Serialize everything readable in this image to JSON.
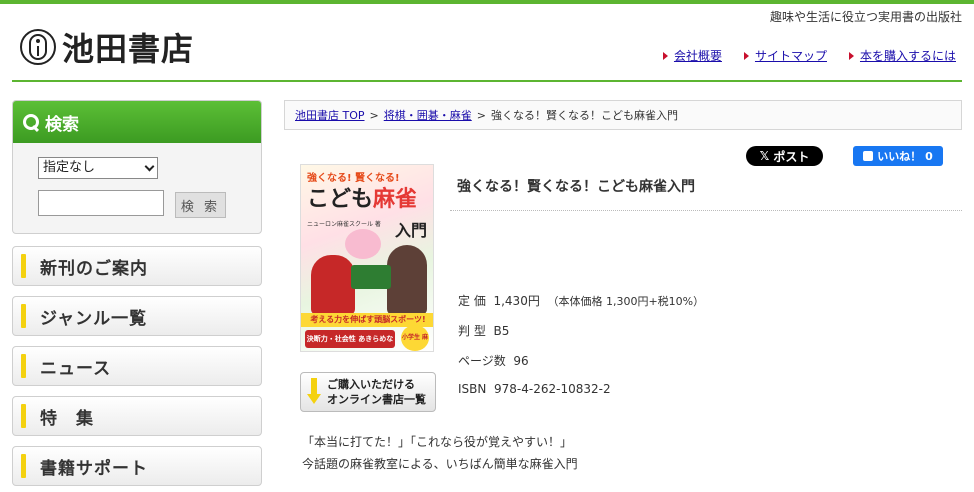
{
  "header": {
    "tagline": "趣味や生活に役立つ実用書の出版社",
    "logo_text": "池田書店",
    "links": [
      "会社概要",
      "サイトマップ",
      "本を購入するには"
    ]
  },
  "sidebar": {
    "search_title": "検索",
    "select_value": "指定なし",
    "search_input_value": "",
    "search_button": "検 索",
    "menu": [
      "新刊のご案内",
      "ジャンル一覧",
      "ニュース",
      "特　集",
      "書籍サポート"
    ]
  },
  "main": {
    "breadcrumb": [
      "池田書店 TOP",
      "将棋・囲碁・麻雀",
      "強くなる！賢くなる！こども麻雀入門"
    ],
    "breadcrumb_sep": ">",
    "post_button": "ポスト",
    "like_button": "いいね！ 0",
    "book": {
      "title": "強くなる！賢くなる！こども麻雀入門",
      "price_label": "定 価",
      "price": "1,430円",
      "price_note": "（本体価格 1,300円+税10%）",
      "format_label": "判 型",
      "format": "B5",
      "pages_label": "ページ数",
      "pages": "96",
      "isbn_label": "ISBN",
      "isbn": "978-4-262-10832-2",
      "store_button_line1": "ご購入いただける",
      "store_button_line2": "オンライン書店一覧",
      "desc_line1": "「本当に打てた！」「これなら役が覚えやすい！」",
      "desc_line2": "今話題の麻雀教室による、いちばん簡単な麻雀入門"
    },
    "cover": {
      "top_text": "強くなる! 賢くなる!",
      "title_a": "こども",
      "title_b": "麻雀",
      "title_c": "入門",
      "author": "ニューロン麻雀スクール 著",
      "band": "考える力を伸ばす頭脳スポーツ!",
      "band2": "決断力・社会性 あきらめない力",
      "badge": "小学生 麻雀が 大好き"
    }
  },
  "colors": {
    "brand_green": "#5cb531",
    "accent_yellow": "#f4d10f",
    "link": "#1a0dab"
  }
}
